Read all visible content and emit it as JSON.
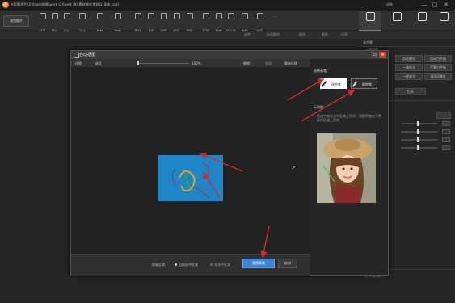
{
  "app": {
    "title": "光影魔术手 [E:\\tools\\图像\\work (2)\\work (8)\\素材\\图片素材\\2_副本.png]"
  },
  "window_controls": {
    "skin": "皮肤",
    "minimize": "—",
    "maximize": "□",
    "close": "✕"
  },
  "toolbar": {
    "open_label": "浏览图片",
    "items": [
      {
        "label": "打开",
        "icon": "folder-icon"
      },
      {
        "label": "保存",
        "icon": "save-icon"
      },
      {
        "label": "另存",
        "icon": "save-as-icon"
      },
      {
        "label": "尺寸",
        "icon": "resize-icon"
      },
      {
        "label": "裁剪",
        "icon": "crop-icon"
      },
      {
        "label": "旋转",
        "icon": "rotate-icon"
      },
      {
        "label": "素材",
        "icon": "material-icon"
      },
      {
        "label": "边框",
        "icon": "frame-icon"
      },
      {
        "label": "拼图",
        "icon": "collage-icon"
      },
      {
        "label": "模板",
        "icon": "template-icon"
      },
      {
        "label": "调色",
        "icon": "color-icon"
      },
      {
        "label": "抠图",
        "icon": "cutout-icon"
      },
      {
        "label": "数字",
        "icon": "number-icon"
      },
      {
        "label": "批处理",
        "icon": "batch-icon"
      },
      {
        "label": "查看",
        "icon": "view-icon"
      },
      {
        "label": "工具",
        "icon": "tools-icon"
      }
    ],
    "more": "···"
  },
  "right_tabs": [
    {
      "label": "基本调整",
      "icon": "adjust-icon",
      "active": true
    },
    {
      "label": "数码暗房",
      "icon": "camera-icon",
      "active": false
    },
    {
      "label": "文字",
      "icon": "text-icon",
      "active": false
    },
    {
      "label": "水印",
      "icon": "watermark-icon",
      "active": false
    }
  ],
  "subbar": {
    "items": [
      "旋转",
      "向右翻转",
      "撤销",
      "重做",
      "还原"
    ]
  },
  "right_panel": {
    "header": "直方图",
    "section_one_click": "一键设置",
    "buttons": [
      [
        "自动曝光",
        "自动白平衡"
      ],
      [
        "一键补光",
        "严重白平衡"
      ],
      [
        "一键减光",
        "高ISO降噪"
      ]
    ],
    "open_more": "打开"
  },
  "dialog": {
    "title": "自动抠图",
    "tools": {
      "undo": "还原",
      "zoom_in": "放大",
      "zoom_value": "100%",
      "redo_undo": "撤销",
      "redo": "重做",
      "reset": "重新选择"
    },
    "side": {
      "select_pen_label": "选择画笔：",
      "pen_keep": "选中笔",
      "pen_remove": "删除笔",
      "example_label": "示例图：",
      "example_desc": "用选中笔在选中区域上划线，用删除笔在不需要的区域上划线"
    },
    "bottom": {
      "keep_label": "保留区域：",
      "option_current": "当前选中区域",
      "option_other": "非选中区域",
      "start": "替换背景",
      "cancel": "取消"
    }
  },
  "bottom_panel": {
    "histogram_item": "红外暗角模式"
  },
  "colors": {
    "accent": "#3a87d8",
    "close": "#d23b2b",
    "preview_blue": "#1d86c6",
    "arrow": "#d22a2a"
  }
}
